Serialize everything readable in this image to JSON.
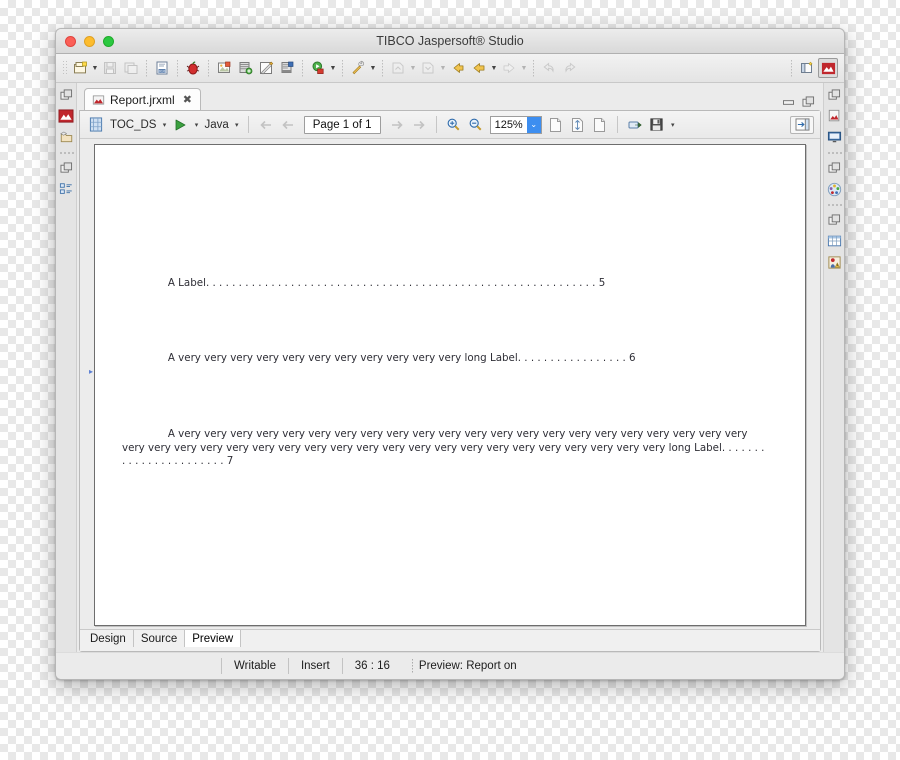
{
  "window": {
    "title": "TIBCO Jaspersoft® Studio",
    "traffic_lights": [
      "close-button",
      "minimize-button",
      "maximize-button"
    ]
  },
  "toolbar": {
    "groups": [
      {
        "items": [
          {
            "name": "new-report-button",
            "icon": "new-file-icon",
            "caret": true,
            "enabled": true
          },
          {
            "name": "save-button",
            "icon": "save-disk-icon",
            "caret": false,
            "enabled": false
          },
          {
            "name": "save-all-button",
            "icon": "save-all-icon",
            "caret": false,
            "enabled": false
          }
        ]
      },
      {
        "items": [
          {
            "name": "compile-report-button",
            "icon": "binary-doc-icon",
            "caret": false,
            "enabled": true
          }
        ]
      },
      {
        "items": [
          {
            "name": "debug-button",
            "icon": "bug-icon",
            "caret": false,
            "enabled": true
          },
          {
            "name": "image-button",
            "icon": "picture-icon",
            "caret": false,
            "enabled": true
          },
          {
            "name": "database-button",
            "icon": "database-icon",
            "caret": false,
            "enabled": true
          },
          {
            "name": "edit-expression-button",
            "icon": "pencil-doc-icon",
            "caret": false,
            "enabled": true
          },
          {
            "name": "export-button",
            "icon": "export-doc-icon",
            "caret": false,
            "enabled": true
          }
        ]
      },
      {
        "items": [
          {
            "name": "run-report-button",
            "icon": "run-green-icon",
            "caret": true,
            "enabled": true
          }
        ]
      },
      {
        "items": [
          {
            "name": "external-tools-button",
            "icon": "wrench-icon",
            "caret": true,
            "enabled": true
          }
        ]
      },
      {
        "items": [
          {
            "name": "previous-annotation-button",
            "icon": "annotation-icon",
            "caret": true,
            "enabled": false
          },
          {
            "name": "next-annotation-button",
            "icon": "annotation-next-icon",
            "caret": true,
            "enabled": false
          },
          {
            "name": "back-button",
            "icon": "arrow-back-yellow-icon",
            "caret": false,
            "enabled": true
          },
          {
            "name": "back-history-button",
            "icon": "arrow-left-yellow-icon",
            "caret": true,
            "enabled": true
          },
          {
            "name": "forward-history-button",
            "icon": "arrow-right-gray-icon",
            "caret": true,
            "enabled": false
          }
        ]
      },
      {
        "items": [
          {
            "name": "undo-button",
            "icon": "undo-arrow-icon",
            "caret": false,
            "enabled": false
          },
          {
            "name": "redo-button",
            "icon": "redo-arrow-icon",
            "caret": false,
            "enabled": false
          }
        ]
      }
    ],
    "perspectives": [
      {
        "name": "open-perspective-button",
        "icon": "open-perspective-icon",
        "active": false
      },
      {
        "name": "perspective-report-design",
        "icon": "report-design-icon",
        "active": true
      }
    ]
  },
  "left_rail": [
    {
      "name": "restore-view-icon",
      "icon": "restore-icon"
    },
    {
      "name": "rail-report-editor-icon",
      "icon": "report-red-chart-icon"
    },
    {
      "name": "rail-repository-icon",
      "icon": "folder-repository-icon"
    },
    {
      "name": "rail-dots-separator",
      "icon": "dots-icon"
    },
    {
      "name": "restore-view-icon-2",
      "icon": "restore-icon"
    },
    {
      "name": "rail-outline-icon",
      "icon": "outline-tree-icon"
    }
  ],
  "right_rail": [
    {
      "name": "restore-view-icon-3",
      "icon": "restore-icon"
    },
    {
      "name": "rail-preview-icon",
      "icon": "report-preview-icon"
    },
    {
      "name": "rail-console-icon",
      "icon": "console-monitor-icon"
    },
    {
      "name": "rail-dots-separator-2",
      "icon": "dots-icon"
    },
    {
      "name": "restore-view-icon-4",
      "icon": "restore-icon"
    },
    {
      "name": "rail-palette-icon",
      "icon": "palette-icon"
    },
    {
      "name": "rail-dots-separator-3",
      "icon": "dots-icon"
    },
    {
      "name": "restore-view-icon-5",
      "icon": "restore-icon"
    },
    {
      "name": "rail-properties-icon",
      "icon": "table-properties-icon"
    },
    {
      "name": "rail-problems-icon",
      "icon": "problems-warning-icon"
    }
  ],
  "editor_tab": {
    "label": "Report.jrxml",
    "close_glyph": "✖",
    "minimize": "minimize-icon",
    "maximize": "maximize-icon"
  },
  "preview_toolbar": {
    "dataset_icon": "dataset-icon",
    "dataset_label": "TOC_DS",
    "dataset_caret": "▾",
    "run_icon": "run-play-icon",
    "run_caret": "▾",
    "language_label": "Java",
    "language_caret": "▾",
    "first_page_label": "first-page-icon",
    "prev_page_label": "previous-page-icon",
    "page_indicator": "Page 1 of 1",
    "next_page_label": "next-page-icon",
    "last_page_label": "last-page-icon",
    "zoom_in": "zoom-in-icon",
    "zoom_out": "zoom-out-icon",
    "zoom_value": "125%",
    "zoom_caret": "⌄",
    "actual_size": "actual-size-icon",
    "fit_page": "fit-page-icon",
    "fit_width": "fit-width-icon",
    "export_icon": "export-icon",
    "save_icon": "save-icon",
    "save_caret": "▾",
    "toggle_panel": "toggle-panel-icon"
  },
  "document": {
    "toc_entries": [
      {
        "label": "A Label",
        "leader": ". . . . . . . . . . . . . . . . . . . . . . . . . . . . . . . . . . . . . . . . . . . . . . . . . . . . . . . . . . . . ",
        "page": "5"
      },
      {
        "label": "A very very very very very very very very very very very long Label",
        "leader": ". . . . . . . . . . . . . . . . . ",
        "page": "6"
      },
      {
        "label": "A very very very very very very very very very very very very very very very very very very very very very very very very very very very very very very very very very very very very very very very very very very very long Label",
        "leader": ". . . . . . . . . . . . . . . . . . . . . . . ",
        "page": "7"
      }
    ],
    "row_marker": "▸"
  },
  "bottom_tabs": [
    {
      "label": "Design",
      "active": false
    },
    {
      "label": "Source",
      "active": false
    },
    {
      "label": "Preview",
      "active": true
    }
  ],
  "status_bar": {
    "writable": "Writable",
    "insert": "Insert",
    "position": "36 : 16",
    "message": "Preview: Report on"
  },
  "colors": {
    "accent_blue": "#3d8ef0",
    "brand_red": "#c0272d",
    "run_green": "#37a03c",
    "window_chrome": "#ebebeb",
    "page_text": "#2e2e36"
  }
}
